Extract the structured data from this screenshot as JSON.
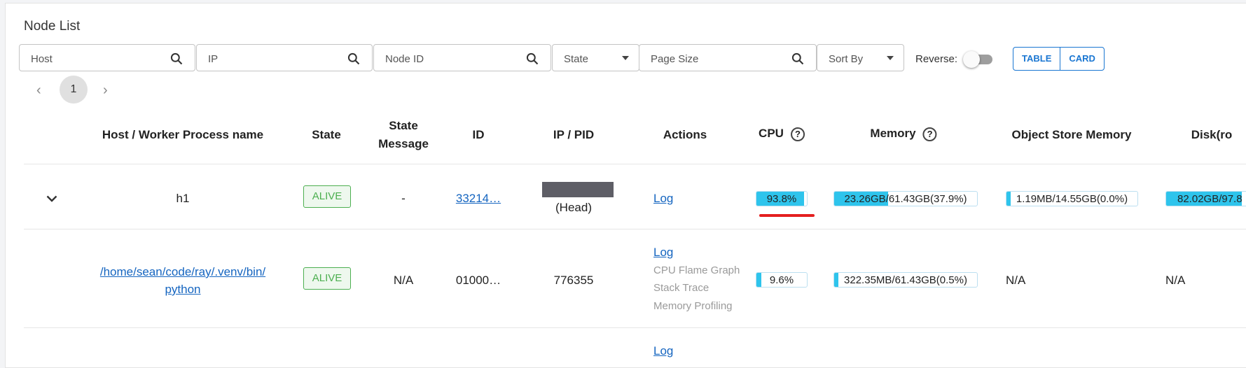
{
  "page": {
    "title": "Node List"
  },
  "toolbar": {
    "host_placeholder": "Host",
    "ip_placeholder": "IP",
    "node_id_placeholder": "Node ID",
    "state_label": "State",
    "page_size_placeholder": "Page Size",
    "sort_by_label": "Sort By",
    "reverse_label": "Reverse:",
    "table_button": "TABLE",
    "card_button": "CARD"
  },
  "pagination": {
    "prev": "‹",
    "current": "1",
    "next": "›"
  },
  "table": {
    "headers": {
      "host": "Host / Worker Process name",
      "state": "State",
      "state_message_1": "State",
      "state_message_2": "Message",
      "id": "ID",
      "ip_pid": "IP / PID",
      "actions": "Actions",
      "cpu": "CPU",
      "memory": "Memory",
      "object_store": "Object Store Memory",
      "disk": "Disk(ro"
    },
    "rows": [
      {
        "host": "h1",
        "state": "ALIVE",
        "state_message": "-",
        "id": "33214…",
        "ip_pid": "(Head)",
        "actions": {
          "log": "Log"
        },
        "cpu": {
          "text": "93.8%",
          "fraction": 0.938
        },
        "memory": {
          "text": "23.26GB/61.43GB(37.9%)",
          "fraction": 0.379
        },
        "object_store": {
          "text": "1.19MB/14.55GB(0.0%)",
          "fraction": 0.0
        },
        "disk": {
          "text": "82.02GB/97.8",
          "fraction": 0.84
        }
      },
      {
        "host_line1": "/home/sean/code/ray/.venv/bin/",
        "host_line2": "python",
        "state": "ALIVE",
        "state_message": "N/A",
        "id": "01000…",
        "ip_pid": "776355",
        "actions": {
          "log": "Log",
          "flame": "CPU Flame Graph",
          "stack": "Stack Trace",
          "memory": "Memory Profiling"
        },
        "cpu": {
          "text": "9.6%",
          "fraction": 0.096
        },
        "memory": {
          "text": "322.35MB/61.43GB(0.5%)",
          "fraction": 0.005
        },
        "object_store": "N/A",
        "disk": "N/A"
      },
      {
        "actions": {
          "log": "Log"
        }
      }
    ]
  },
  "colors": {
    "accent": "#1976d2",
    "bar_fill": "#2ec4ec",
    "alive": "#4caf50",
    "highlight": "#e41f1f"
  }
}
